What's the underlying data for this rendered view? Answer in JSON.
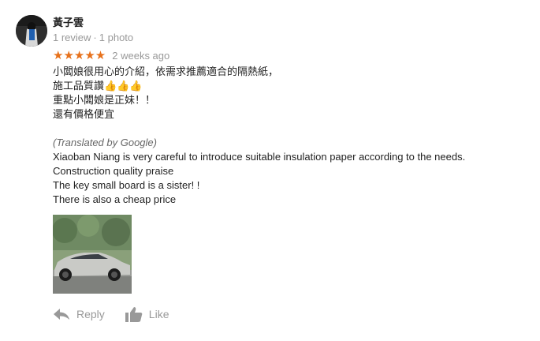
{
  "reviewer": {
    "name": "黃子雲",
    "review_count": "1 review",
    "photo_count": "1 photo"
  },
  "rating": {
    "stars": 5,
    "stars_text": "★★★★★",
    "date": "2 weeks ago",
    "star_color": "#e7711b"
  },
  "review": {
    "original_lines": [
      "小闆娘很用心的介紹，依需求推薦適合的隔熱紙，",
      "施工品質讚👍👍👍",
      "重點小闆娘是正妹！！",
      "還有價格便宜"
    ],
    "translated_label": "(Translated by Google)",
    "translated_lines": [
      "Xiaoban Niang is very careful to introduce suitable insulation paper according to the needs.",
      "Construction quality praise",
      "The key small board is a sister! !",
      "There is also a cheap price"
    ]
  },
  "photo": {
    "icon": "car-photo"
  },
  "actions": {
    "reply_label": "Reply",
    "like_label": "Like",
    "reply_icon": "reply-arrow-icon",
    "like_icon": "thumbs-up-icon"
  },
  "colors": {
    "secondary_text": "#999999",
    "accent_star": "#e7711b"
  }
}
